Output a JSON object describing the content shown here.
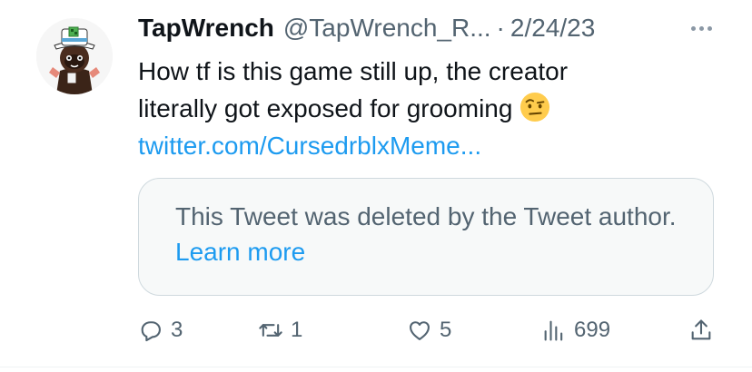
{
  "tweet": {
    "author": {
      "display_name": "TapWrench",
      "handle": "@TapWrench_R...",
      "avatar_icon": "cartoon-character-avatar-icon"
    },
    "separator": "·",
    "date": "2/24/23",
    "text_line1": "How tf is this game still up, the creator",
    "text_line2": "literally got exposed for grooming",
    "emoji": "raised-eyebrow-emoji",
    "link_text": "twitter.com/CursedrblxMeme..."
  },
  "quoted": {
    "message": "This Tweet was deleted by the Tweet author.",
    "learn_more": "Learn more"
  },
  "actions": {
    "replies": "3",
    "retweets": "1",
    "likes": "5",
    "views": "699"
  },
  "colors": {
    "accent": "#1d9bf0",
    "secondary_text": "#536471",
    "card_border": "#cfd9de",
    "card_bg": "#f7f9f9"
  }
}
